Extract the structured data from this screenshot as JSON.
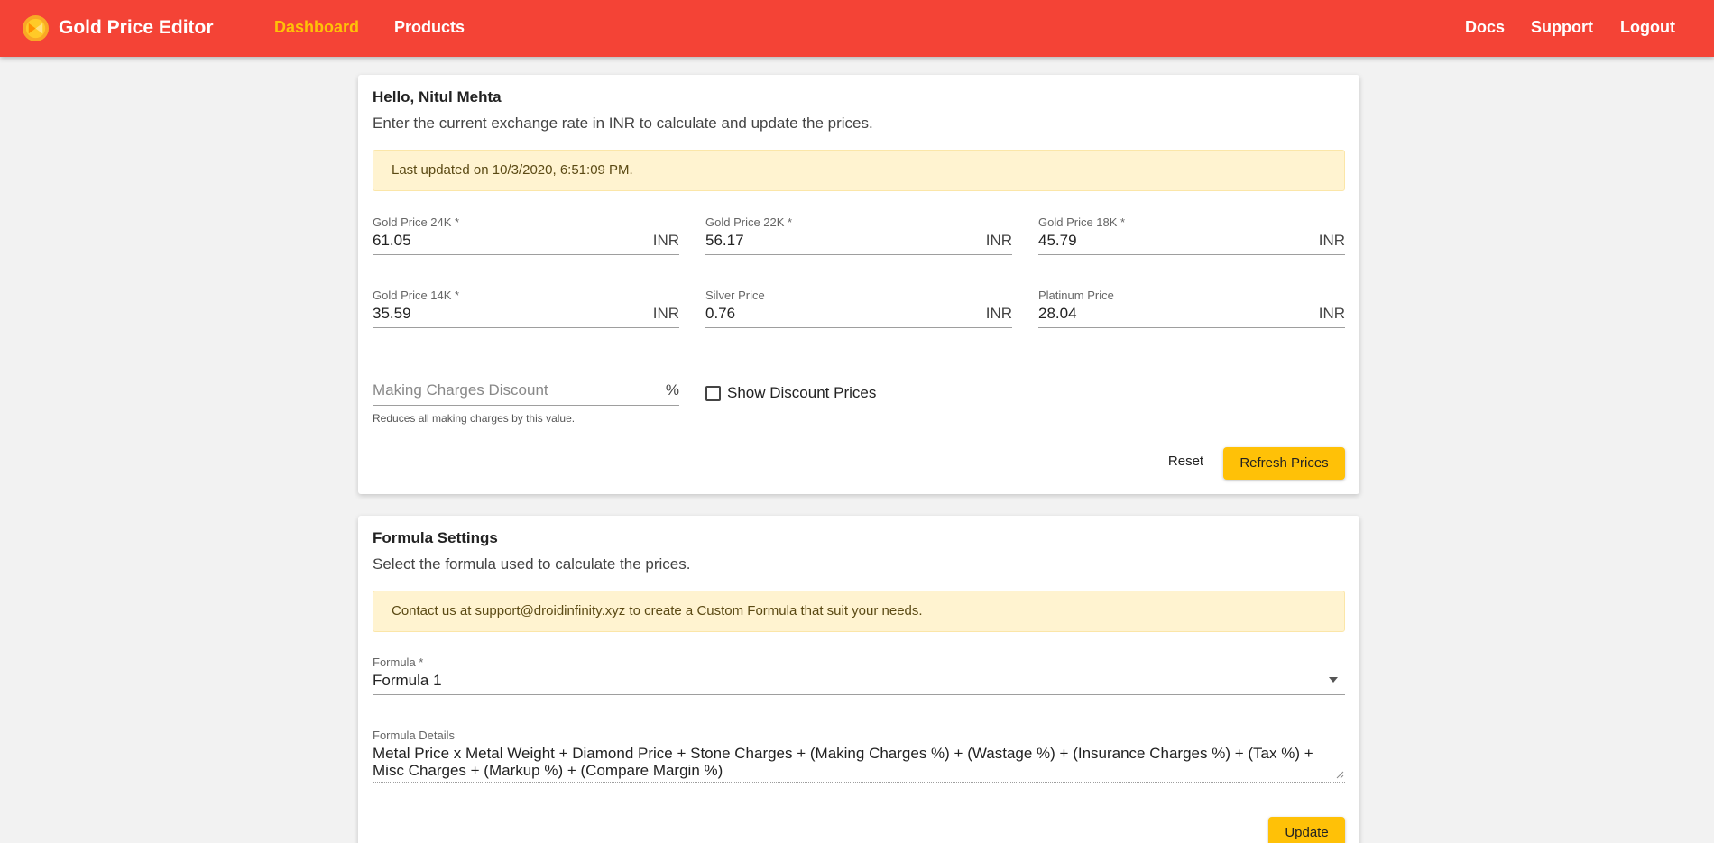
{
  "app": {
    "name": "Gold Price Editor",
    "logo_icon": "gold-coin-icon",
    "accent_color": "#f44336",
    "highlight_color": "#ffc107"
  },
  "nav": {
    "left": [
      {
        "label": "Dashboard",
        "active": true
      },
      {
        "label": "Products",
        "active": false
      }
    ],
    "right": [
      {
        "label": "Docs"
      },
      {
        "label": "Support"
      },
      {
        "label": "Logout"
      }
    ]
  },
  "prices_card": {
    "greeting": "Hello, Nitul Mehta",
    "subtitle": "Enter the current exchange rate in INR to calculate and update the prices.",
    "alert": "Last updated on 10/3/2020, 6:51:09 PM.",
    "fields": [
      {
        "label": "Gold Price 24K *",
        "value": "61.05",
        "suffix": "INR"
      },
      {
        "label": "Gold Price 22K *",
        "value": "56.17",
        "suffix": "INR"
      },
      {
        "label": "Gold Price 18K *",
        "value": "45.79",
        "suffix": "INR"
      },
      {
        "label": "Gold Price 14K *",
        "value": "35.59",
        "suffix": "INR"
      },
      {
        "label": "Silver Price",
        "value": "0.76",
        "suffix": "INR"
      },
      {
        "label": "Platinum Price",
        "value": "28.04",
        "suffix": "INR"
      }
    ],
    "discount": {
      "placeholder": "Making Charges Discount",
      "suffix": "%",
      "helper": "Reduces all making charges by this value."
    },
    "show_discount": {
      "label": "Show Discount Prices",
      "checked": false
    },
    "reset_label": "Reset",
    "refresh_label": "Refresh Prices"
  },
  "formula_card": {
    "title": "Formula Settings",
    "subtitle": "Select the formula used to calculate the prices.",
    "alert": "Contact us at support@droidinfinity.xyz to create a Custom Formula that suit your needs.",
    "formula_label": "Formula *",
    "formula_value": "Formula 1",
    "details_label": "Formula Details",
    "details_value": "Metal Price x Metal Weight + Diamond Price + Stone Charges + (Making Charges %) + (Wastage %) + (Insurance Charges %) + (Tax %) + Misc Charges + (Markup %) + (Compare Margin %)",
    "update_label": "Update"
  }
}
